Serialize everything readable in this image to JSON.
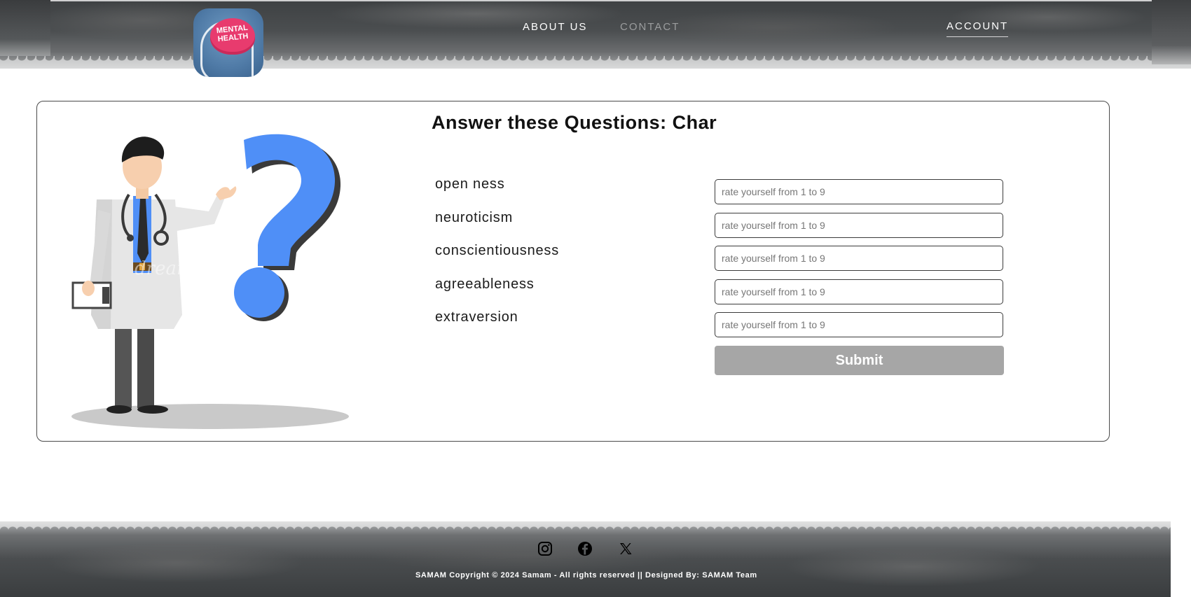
{
  "header": {
    "logo_text_line1": "MENTAL",
    "logo_text_line2": "HEALTH",
    "nav": {
      "about": "ABOUT US",
      "contact": "CONTACT",
      "account": "ACCOUNT"
    }
  },
  "main": {
    "title": "Answer these Questions: Char",
    "illustration": {
      "icon": "doctor-question-illustration",
      "watermark": "dreamstime"
    },
    "questions": [
      {
        "label": "open ness",
        "placeholder": "rate yourself from 1 to 9",
        "value": ""
      },
      {
        "label": "neuroticism",
        "placeholder": "rate yourself from 1 to 9",
        "value": ""
      },
      {
        "label": "conscientiousness",
        "placeholder": "rate yourself from 1 to 9",
        "value": ""
      },
      {
        "label": "agreeableness",
        "placeholder": "rate yourself from 1 to 9",
        "value": ""
      },
      {
        "label": "extraversion",
        "placeholder": "rate yourself from 1 to 9",
        "value": ""
      }
    ],
    "submit_label": "Submit"
  },
  "footer": {
    "social": [
      {
        "icon": "instagram-icon"
      },
      {
        "icon": "facebook-icon"
      },
      {
        "icon": "x-twitter-icon"
      }
    ],
    "copyright": "SAMAM Copyright © 2024 Samam - All rights reserved || Designed By: SAMAM Team"
  },
  "colors": {
    "band_dark": "#3e4143",
    "submit_bg": "#a6a6a6",
    "contact_link": "#9b9d9e",
    "question_mark": "#4f8ff7",
    "logo_brain": "#e83b6e"
  }
}
